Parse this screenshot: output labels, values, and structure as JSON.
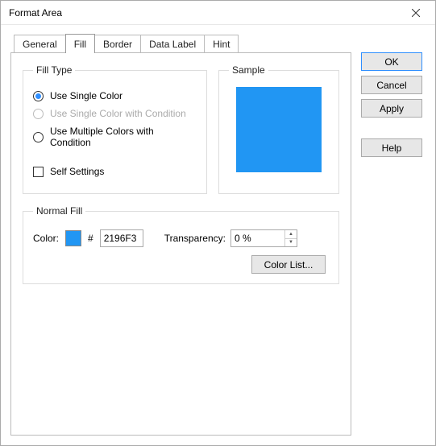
{
  "window": {
    "title": "Format Area"
  },
  "tabs": {
    "items": [
      {
        "label": "General"
      },
      {
        "label": "Fill"
      },
      {
        "label": "Border"
      },
      {
        "label": "Data Label"
      },
      {
        "label": "Hint"
      }
    ],
    "active_index": 1
  },
  "filltype": {
    "legend": "Fill Type",
    "options": {
      "single": "Use Single Color",
      "single_cond": "Use Single Color with Condition",
      "multiple_cond": "Use Multiple Colors with Condition"
    },
    "selected": "single",
    "disabled": [
      "single_cond"
    ],
    "self_settings_label": "Self Settings",
    "self_settings_checked": false
  },
  "sample": {
    "legend": "Sample",
    "color": "#2196F3"
  },
  "normal_fill": {
    "legend": "Normal Fill",
    "color_label": "Color:",
    "hash": "#",
    "hex": "2196F3",
    "transparency_label": "Transparency:",
    "transparency_value": "0 %",
    "color_list_label": "Color List..."
  },
  "buttons": {
    "ok": "OK",
    "cancel": "Cancel",
    "apply": "Apply",
    "help": "Help"
  }
}
